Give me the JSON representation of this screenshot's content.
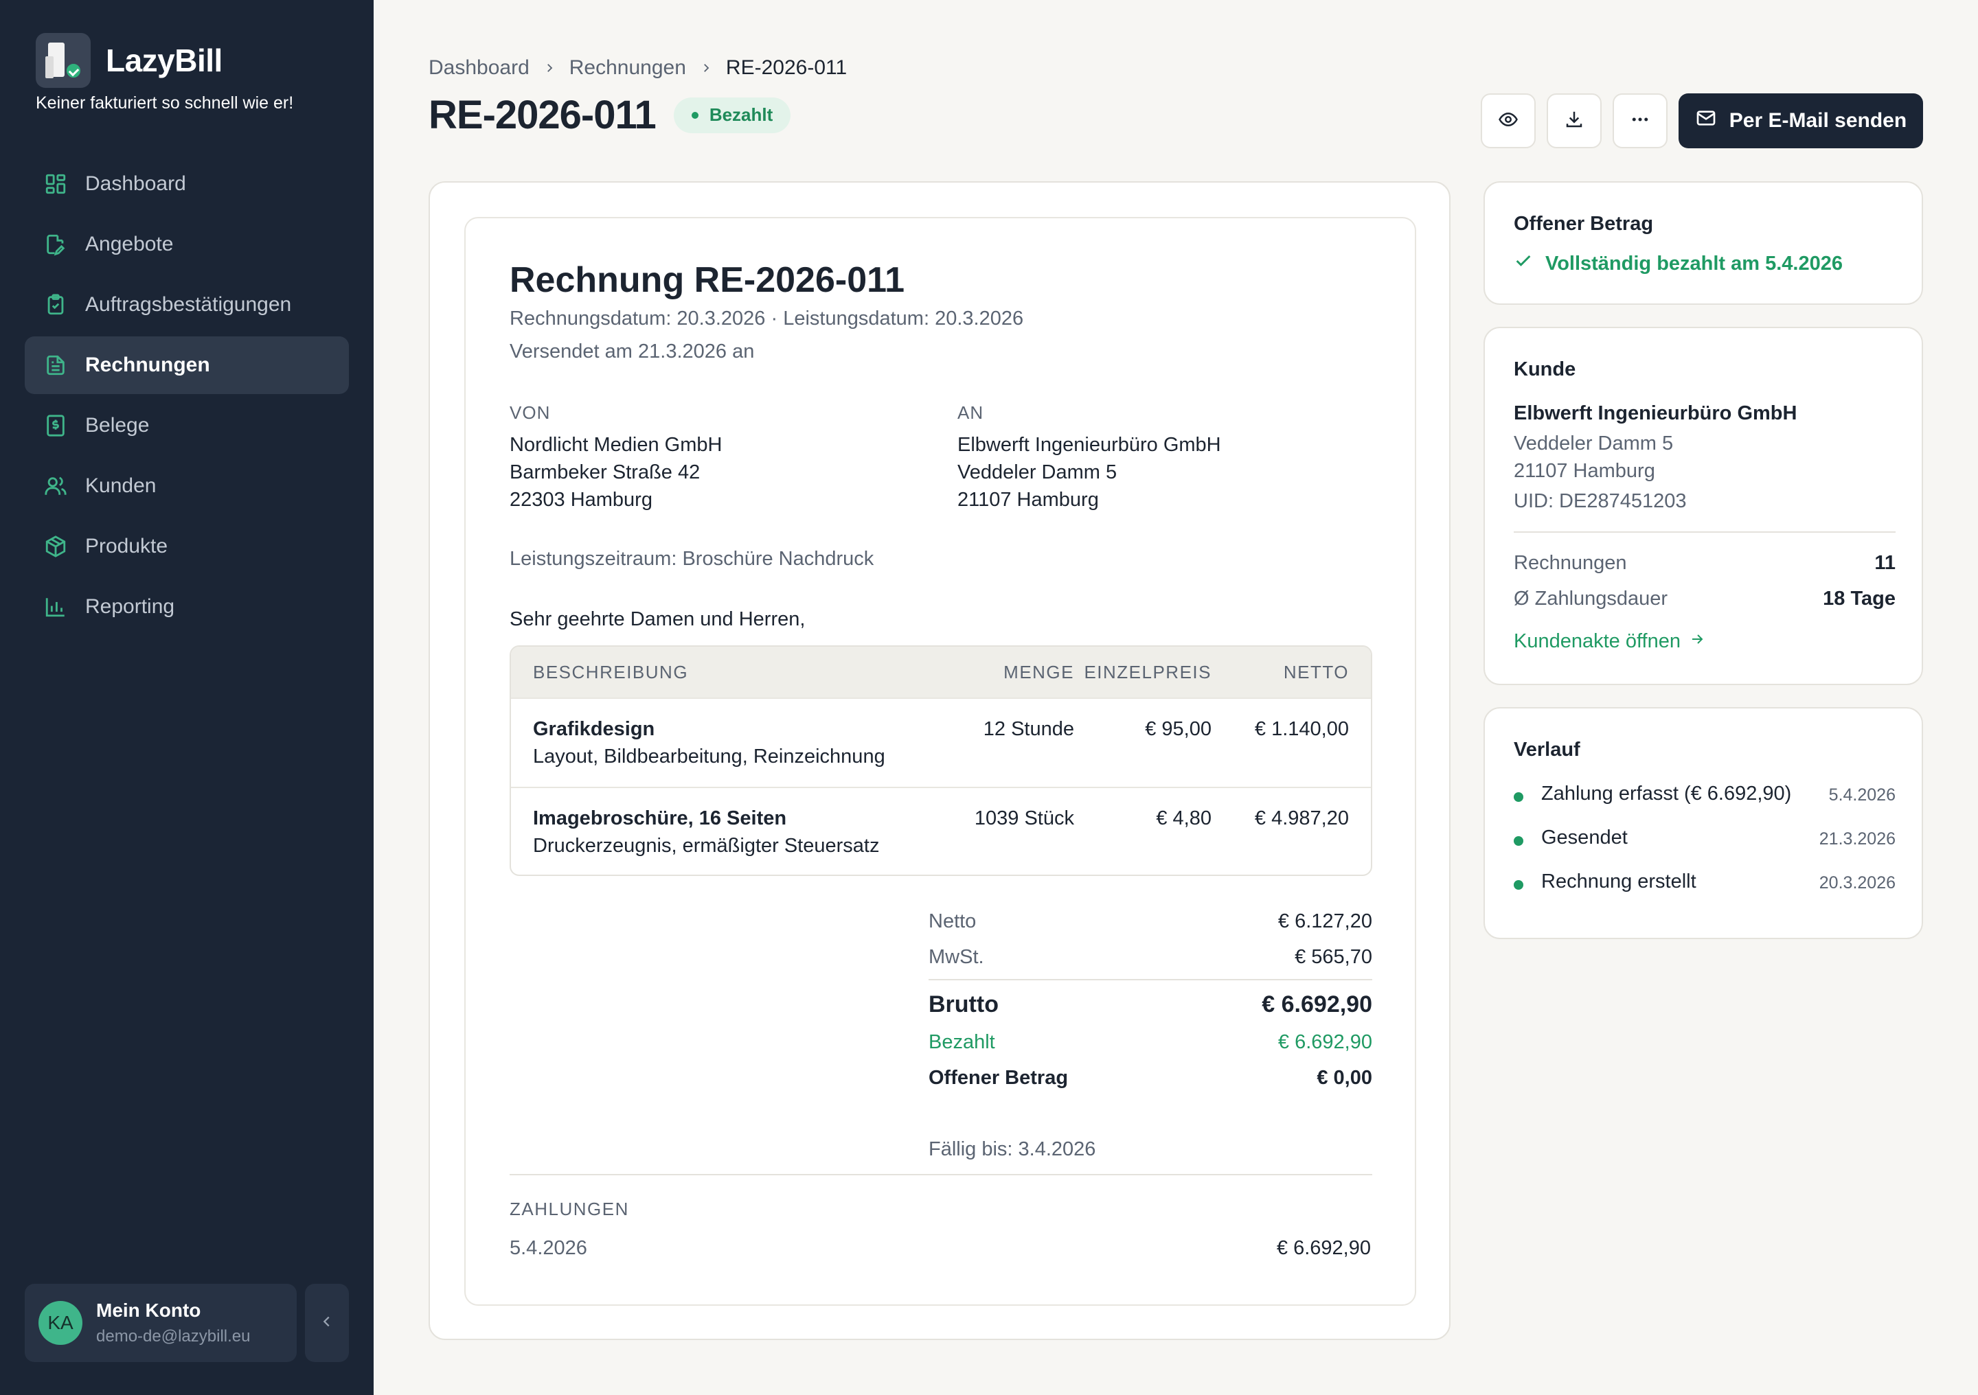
{
  "app": {
    "name": "LazyBill",
    "tagline": "Keiner fakturiert so schnell wie er!"
  },
  "sidebar": {
    "items": [
      {
        "label": "Dashboard",
        "icon": "dashboard-icon"
      },
      {
        "label": "Angebote",
        "icon": "document-edit-icon"
      },
      {
        "label": "Auftragsbestätigungen",
        "icon": "clipboard-check-icon"
      },
      {
        "label": "Rechnungen",
        "icon": "invoice-icon",
        "active": true
      },
      {
        "label": "Belege",
        "icon": "receipt-icon"
      },
      {
        "label": "Kunden",
        "icon": "users-icon"
      },
      {
        "label": "Produkte",
        "icon": "package-icon"
      },
      {
        "label": "Reporting",
        "icon": "bar-chart-icon"
      }
    ],
    "account": {
      "initials": "KA",
      "name": "Mein Konto",
      "email": "demo-de@lazybill.eu"
    }
  },
  "header": {
    "breadcrumb": [
      "Dashboard",
      "Rechnungen",
      "RE-2026-011"
    ],
    "title": "RE-2026-011",
    "status": "Bezahlt",
    "send_button": "Per E-Mail senden"
  },
  "invoice": {
    "title": "Rechnung RE-2026-011",
    "dates": "Rechnungsdatum: 20.3.2026 · Leistungsdatum: 20.3.2026",
    "sent": "Versendet am 21.3.2026 an",
    "from": {
      "label": "VON",
      "lines": [
        "Nordlicht Medien GmbH",
        "Barmbeker Straße 42",
        "22303 Hamburg"
      ]
    },
    "to": {
      "label": "AN",
      "lines": [
        "Elbwerft Ingenieurbüro GmbH",
        "Veddeler Damm 5",
        "21107 Hamburg"
      ]
    },
    "period": "Leistungszeitraum: Broschüre Nachdruck",
    "greeting": "Sehr geehrte Damen und Herren,",
    "columns": {
      "description": "BESCHREIBUNG",
      "quantity": "MENGE",
      "unit_price": "EINZELPREIS",
      "net": "NETTO"
    },
    "items": [
      {
        "title": "Grafikdesign",
        "subtitle": "Layout, Bildbearbeitung, Reinzeichnung",
        "quantity": "12 Stunde",
        "unit_price": "€ 95,00",
        "net": "€ 1.140,00"
      },
      {
        "title": "Imagebroschüre, 16 Seiten",
        "subtitle": "Druckerzeugnis, ermäßigter Steuersatz",
        "quantity": "1039 Stück",
        "unit_price": "€ 4,80",
        "net": "€ 4.987,20"
      }
    ],
    "totals": {
      "net_label": "Netto",
      "net": "€ 6.127,20",
      "vat_label": "MwSt.",
      "vat": "€ 565,70",
      "gross_label": "Brutto",
      "gross": "€ 6.692,90",
      "paid_label": "Bezahlt",
      "paid": "€ 6.692,90",
      "open_label": "Offener Betrag",
      "open": "€ 0,00",
      "due": "Fällig bis: 3.4.2026"
    },
    "payments": {
      "label": "ZAHLUNGEN",
      "date": "5.4.2026",
      "amount": "€ 6.692,90"
    }
  },
  "open_amount_card": {
    "title": "Offener Betrag",
    "status": "Vollständig bezahlt am 5.4.2026"
  },
  "customer_card": {
    "title": "Kunde",
    "name": "Elbwerft Ingenieurbüro GmbH",
    "street": "Veddeler Damm 5",
    "city": "21107 Hamburg",
    "vat_id": "UID: DE287451203",
    "invoices_label": "Rechnungen",
    "invoices_count": "11",
    "payment_duration_label": "Ø Zahlungsdauer",
    "payment_duration": "18 Tage",
    "link": "Kundenakte öffnen"
  },
  "history_card": {
    "title": "Verlauf",
    "events": [
      {
        "text": "Zahlung erfasst (€ 6.692,90)",
        "date": "5.4.2026"
      },
      {
        "text": "Gesendet",
        "date": "21.3.2026"
      },
      {
        "text": "Rechnung erstellt",
        "date": "20.3.2026"
      }
    ]
  },
  "colors": {
    "sidebar_bg": "#1b2535",
    "accent_green": "#1f9a63",
    "page_bg": "#f7f6f3"
  }
}
